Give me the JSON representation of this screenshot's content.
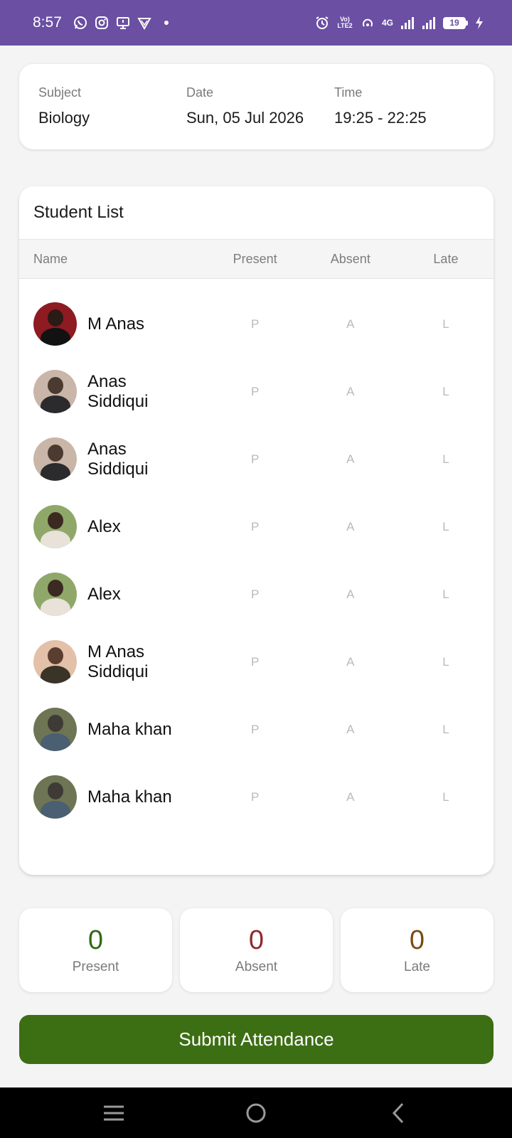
{
  "status_bar": {
    "time": "8:57",
    "network_label": "4G",
    "volte_label": "Vo) LTE2",
    "battery_level": "19",
    "background_color": "#6a4fa3",
    "left_icons": [
      "whatsapp-icon",
      "instagram-icon",
      "screen-icon",
      "shield-icon",
      "dot-icon"
    ],
    "right_icons": [
      "alarm-icon",
      "volte-icon",
      "hotspot-icon",
      "signal-icon",
      "signal-icon",
      "battery-icon",
      "charging-icon"
    ]
  },
  "session": {
    "subject_label": "Subject",
    "subject_value": "Biology",
    "date_label": "Date",
    "date_value": "Sun, 05 Jul 2026",
    "time_label": "Time",
    "time_value": "19:25 - 22:25"
  },
  "student_list": {
    "title": "Student List",
    "columns": [
      "Name",
      "Present",
      "Absent",
      "Late"
    ],
    "mark_labels": {
      "present": "P",
      "absent": "A",
      "late": "L"
    },
    "students": [
      {
        "name": "M Anas"
      },
      {
        "name": "Anas Siddiqui"
      },
      {
        "name": "Anas Siddiqui"
      },
      {
        "name": "Alex"
      },
      {
        "name": "Alex"
      },
      {
        "name": "M Anas Siddiqui"
      },
      {
        "name": "Maha khan"
      },
      {
        "name": "Maha khan"
      }
    ]
  },
  "summary": {
    "present_count": "0",
    "present_label": "Present",
    "absent_count": "0",
    "absent_label": "Absent",
    "late_count": "0",
    "late_label": "Late",
    "present_color": "#2f6b12",
    "absent_color": "#8e2b2b",
    "late_color": "#7a4b13"
  },
  "submit": {
    "label": "Submit Attendance",
    "color": "#3c6e14"
  },
  "nav_bar": {
    "buttons": [
      "menu-icon",
      "home-icon",
      "back-icon"
    ]
  }
}
